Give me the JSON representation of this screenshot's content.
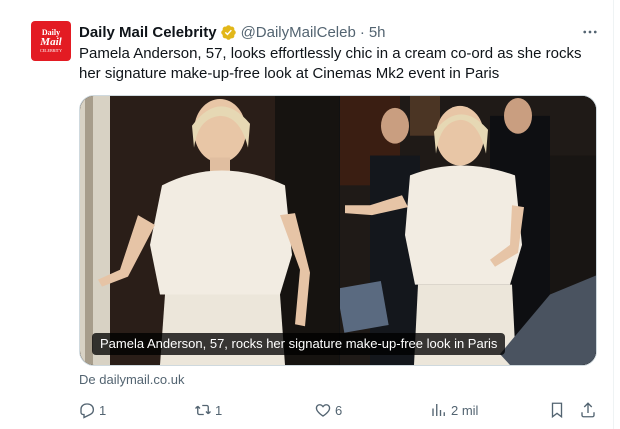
{
  "tweet": {
    "avatar_logo": {
      "line1": "Daily",
      "line2": "Mail",
      "line3": "CELEBRITY"
    },
    "author_name": "Daily Mail Celebrity",
    "handle": "@DailyMailCeleb",
    "separator": "·",
    "time": "5h",
    "text": "Pamela Anderson, 57, looks effortlessly chic in a cream co-ord as she rocks her signature make-up-free look at Cinemas Mk2 event in Paris",
    "media_caption": "Pamela Anderson, 57, rocks her signature make-up-free look in Paris",
    "source": "De dailymail.co.uk"
  },
  "actions": {
    "reply_count": "1",
    "retweet_count": "1",
    "like_count": "6",
    "views_count": "2 mil"
  },
  "colors": {
    "brand_red": "#e31b23",
    "verified_gold": "#e2b719",
    "secondary_text": "#536471"
  },
  "icons": [
    "verified-badge-icon",
    "more-icon",
    "reply-icon",
    "retweet-icon",
    "like-icon",
    "views-icon",
    "bookmark-icon",
    "share-icon"
  ]
}
